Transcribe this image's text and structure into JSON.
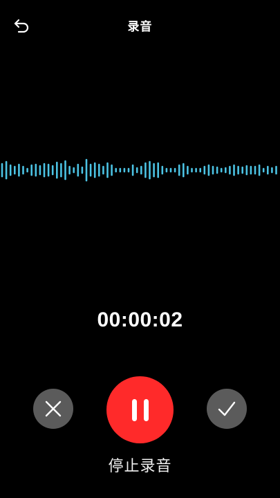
{
  "header": {
    "title": "录音",
    "back_icon": "back-arrow-icon"
  },
  "waveform": {
    "color": "#4cc3e4",
    "icon": "audio-waveform"
  },
  "recording": {
    "elapsed": "00:00:02",
    "status_label": "停止录音"
  },
  "controls": {
    "cancel_icon": "close-icon",
    "pause_icon": "pause-icon",
    "confirm_icon": "checkmark-icon",
    "cancel_bg": "#5b5b5b",
    "confirm_bg": "#5b5b5b",
    "pause_bg": "#ff2a2a"
  }
}
